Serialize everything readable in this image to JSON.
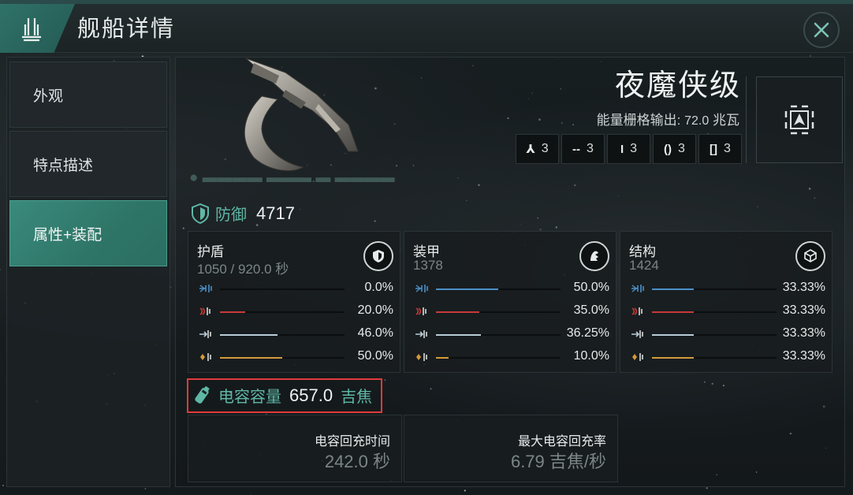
{
  "header": {
    "title": "舰船详情"
  },
  "sidebar": {
    "items": [
      {
        "label": "外观",
        "active": false
      },
      {
        "label": "特点描述",
        "active": false
      },
      {
        "label": "属性+装配",
        "active": true
      }
    ]
  },
  "ship": {
    "name": "夜魔侠级",
    "power_label": "能量栅格输出:",
    "power_value": "72.0",
    "power_unit": "兆瓦",
    "slots": [
      {
        "icon": "high-slot-icon",
        "glyph": "⅄",
        "count": "3"
      },
      {
        "icon": "mid-slot-icon",
        "glyph": "--",
        "count": "3"
      },
      {
        "icon": "low-slot-icon",
        "glyph": "I",
        "count": "3"
      },
      {
        "icon": "rig-slot-icon",
        "glyph": "()",
        "count": "3"
      },
      {
        "icon": "subsystem-slot-icon",
        "glyph": "[]",
        "count": "3"
      }
    ]
  },
  "defense": {
    "title": "防御",
    "value": "4717",
    "cards": [
      {
        "title": "护盾",
        "sub": "1050 / 920.0 秒",
        "icon": "shield-layer-icon",
        "resists": [
          {
            "type": "em",
            "value": "0.0%",
            "fraction": 0.0
          },
          {
            "type": "thermal",
            "value": "20.0%",
            "fraction": 0.2
          },
          {
            "type": "kinetic",
            "value": "46.0%",
            "fraction": 0.46
          },
          {
            "type": "explosive",
            "value": "50.0%",
            "fraction": 0.5
          }
        ]
      },
      {
        "title": "装甲",
        "sub": "1378",
        "icon": "armor-layer-icon",
        "resists": [
          {
            "type": "em",
            "value": "50.0%",
            "fraction": 0.5
          },
          {
            "type": "thermal",
            "value": "35.0%",
            "fraction": 0.35
          },
          {
            "type": "kinetic",
            "value": "36.25%",
            "fraction": 0.3625
          },
          {
            "type": "explosive",
            "value": "10.0%",
            "fraction": 0.1
          }
        ]
      },
      {
        "title": "结构",
        "sub": "1424",
        "icon": "structure-layer-icon",
        "resists": [
          {
            "type": "em",
            "value": "33.33%",
            "fraction": 0.3333
          },
          {
            "type": "thermal",
            "value": "33.33%",
            "fraction": 0.3333
          },
          {
            "type": "kinetic",
            "value": "33.33%",
            "fraction": 0.3333
          },
          {
            "type": "explosive",
            "value": "33.33%",
            "fraction": 0.3333
          }
        ]
      }
    ]
  },
  "capacitor": {
    "title": "电容容量",
    "value": "657.0",
    "unit": "吉焦",
    "recharge_label": "电容回充时间",
    "recharge_value": "242.0 秒",
    "peak_label": "最大电容回充率",
    "peak_value": "6.79 吉焦/秒"
  },
  "colors": {
    "accent": "#5fb7a6",
    "em": "#4a90c8",
    "thermal": "#c83a3a",
    "kinetic": "#b8ccd8",
    "explosive": "#d49a3a",
    "highlight": "#e23a3a"
  }
}
